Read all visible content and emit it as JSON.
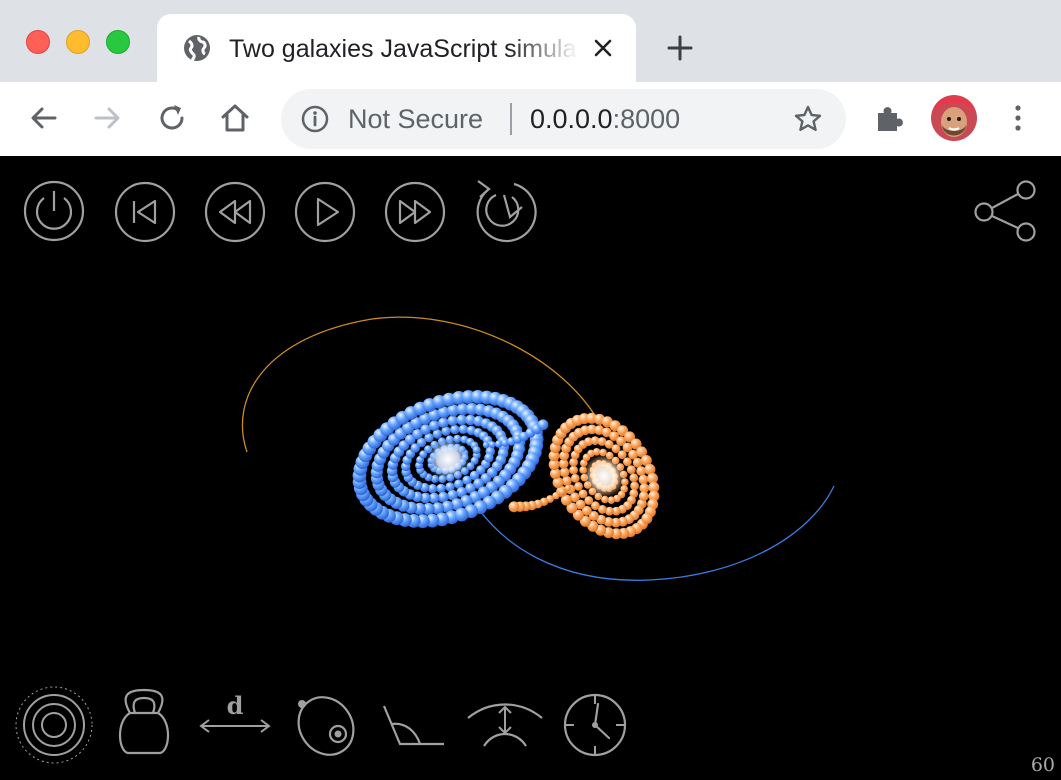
{
  "browser": {
    "tab_title": "Two galaxies JavaScript simulation",
    "address": {
      "security_label": "Not Secure",
      "host": "0.0.0.0",
      "port": ":8000"
    }
  },
  "simulation": {
    "top_controls": [
      "power-icon",
      "skip-to-start-icon",
      "rewind-icon",
      "play-icon",
      "fast-forward-icon",
      "reload-icon"
    ],
    "bottom_controls": [
      "galaxy-rings-icon",
      "mass-kettlebell-icon",
      "distance-icon",
      "ellipse-orbit-icon",
      "angle-icon",
      "arc-curvature-icon",
      "clock-icon"
    ],
    "distance_label": "d",
    "fps": "60",
    "colors": {
      "blue_galaxy": "#5aa0ff",
      "orange_galaxy": "#ffa45a",
      "blue_orbit": "#3d7ae0",
      "orange_orbit": "#c98a26",
      "control_stroke": "#a0a0a0"
    }
  }
}
